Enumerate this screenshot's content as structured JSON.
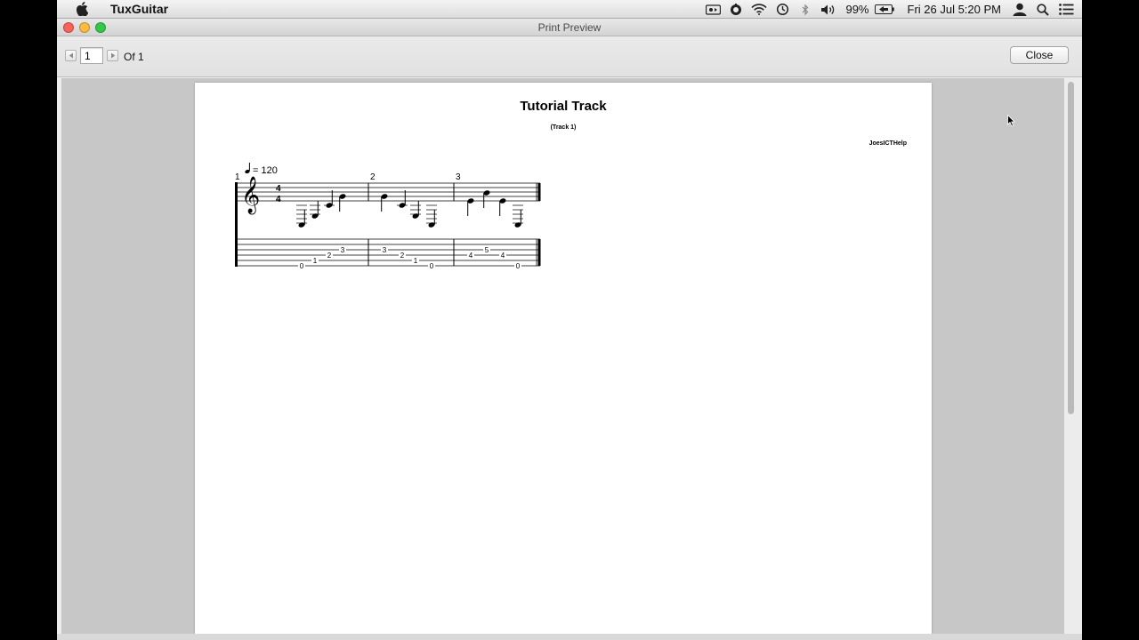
{
  "menubar": {
    "app_name": "TuxGuitar",
    "battery": "99%",
    "datetime": "Fri 26 Jul  5:20 PM",
    "icons": [
      "apple-icon",
      "screen-record-icon",
      "sync-icon",
      "wifi-icon",
      "time-machine-icon",
      "bluetooth-icon",
      "volume-icon",
      "battery-icon",
      "user-icon",
      "spotlight-icon",
      "notification-center-icon"
    ]
  },
  "window": {
    "title": "Print Preview",
    "traffic_lights": {
      "close": "#fc605b",
      "minimize": "#fdbc40",
      "zoom": "#34c84a"
    }
  },
  "toolbar": {
    "page_value": "1",
    "of_label": "Of 1",
    "close_label": "Close"
  },
  "document": {
    "title": "Tutorial Track",
    "subtitle": "(Track 1)",
    "author": "JoesICTHelp",
    "tempo_value": "= 120",
    "time_signature": [
      "4",
      "4"
    ],
    "measures": [
      {
        "number": "1",
        "tab": [
          {
            "string": 6,
            "fret": "0"
          },
          {
            "string": 5,
            "fret": "1"
          },
          {
            "string": 4,
            "fret": "2"
          },
          {
            "string": 3,
            "fret": "3"
          }
        ]
      },
      {
        "number": "2",
        "tab": [
          {
            "string": 3,
            "fret": "3"
          },
          {
            "string": 4,
            "fret": "2"
          },
          {
            "string": 5,
            "fret": "1"
          },
          {
            "string": 6,
            "fret": "0"
          }
        ]
      },
      {
        "number": "3",
        "tab": [
          {
            "string": 4,
            "fret": "4"
          },
          {
            "string": 3,
            "fret": "5"
          },
          {
            "string": 4,
            "fret": "4"
          },
          {
            "string": 6,
            "fret": "0"
          }
        ]
      }
    ]
  }
}
